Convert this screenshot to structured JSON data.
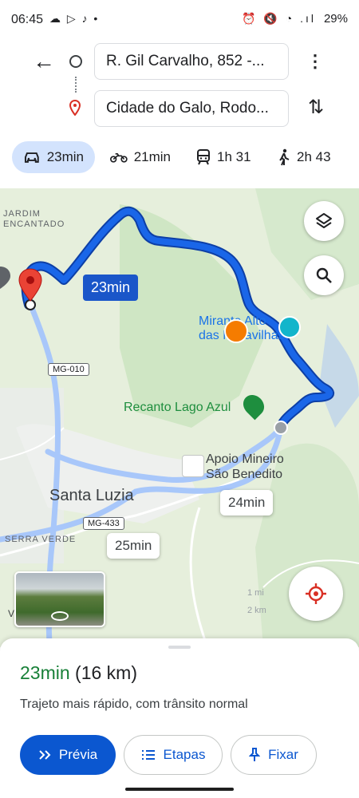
{
  "status_bar": {
    "time": "06:45",
    "left_icons": "☁ ▷ ♪ •",
    "right_icons": "⏰ 🔇 ◔ .ıl",
    "battery": "29%"
  },
  "directions": {
    "origin": "R. Gil Carvalho, 852 -...",
    "destination": "Cidade do Galo, Rodo..."
  },
  "modes": [
    {
      "name": "car",
      "label": "23min",
      "active": true
    },
    {
      "name": "motorcycle",
      "label": "21min",
      "active": false
    },
    {
      "name": "transit",
      "label": "1h 31",
      "active": false
    },
    {
      "name": "walk",
      "label": "2h 43",
      "active": false
    }
  ],
  "map": {
    "route_label": "23min",
    "alt_route_labels": [
      "24min",
      "25min"
    ],
    "places": {
      "jardim": "JARDIM ENCANTADO",
      "santa_luzia": "Santa Luzia",
      "apoio_line1": "Apoio Mineiro",
      "apoio_line2": "São Benedito",
      "recanto": "Recanto Lago Azul",
      "mirante_line1": "Mirante Alto",
      "mirante_line2": "das Maravilhas",
      "serra_verde": "SERRA VERDE"
    },
    "shields": [
      "MG-010",
      "MG-433"
    ],
    "scale_labels": [
      "1 mi",
      "2 km"
    ],
    "street_view_label": "V",
    "colors": {
      "route": "#1a66e8",
      "route_outline": "#0d3fa6",
      "alt_route": "#a8c7fa"
    }
  },
  "sheet": {
    "duration": "23min",
    "distance": "(16 km)",
    "subtitle": "Trajeto mais rápido, com trânsito normal",
    "buttons": {
      "preview": "Prévia",
      "steps": "Etapas",
      "pin": "Fixar"
    }
  }
}
